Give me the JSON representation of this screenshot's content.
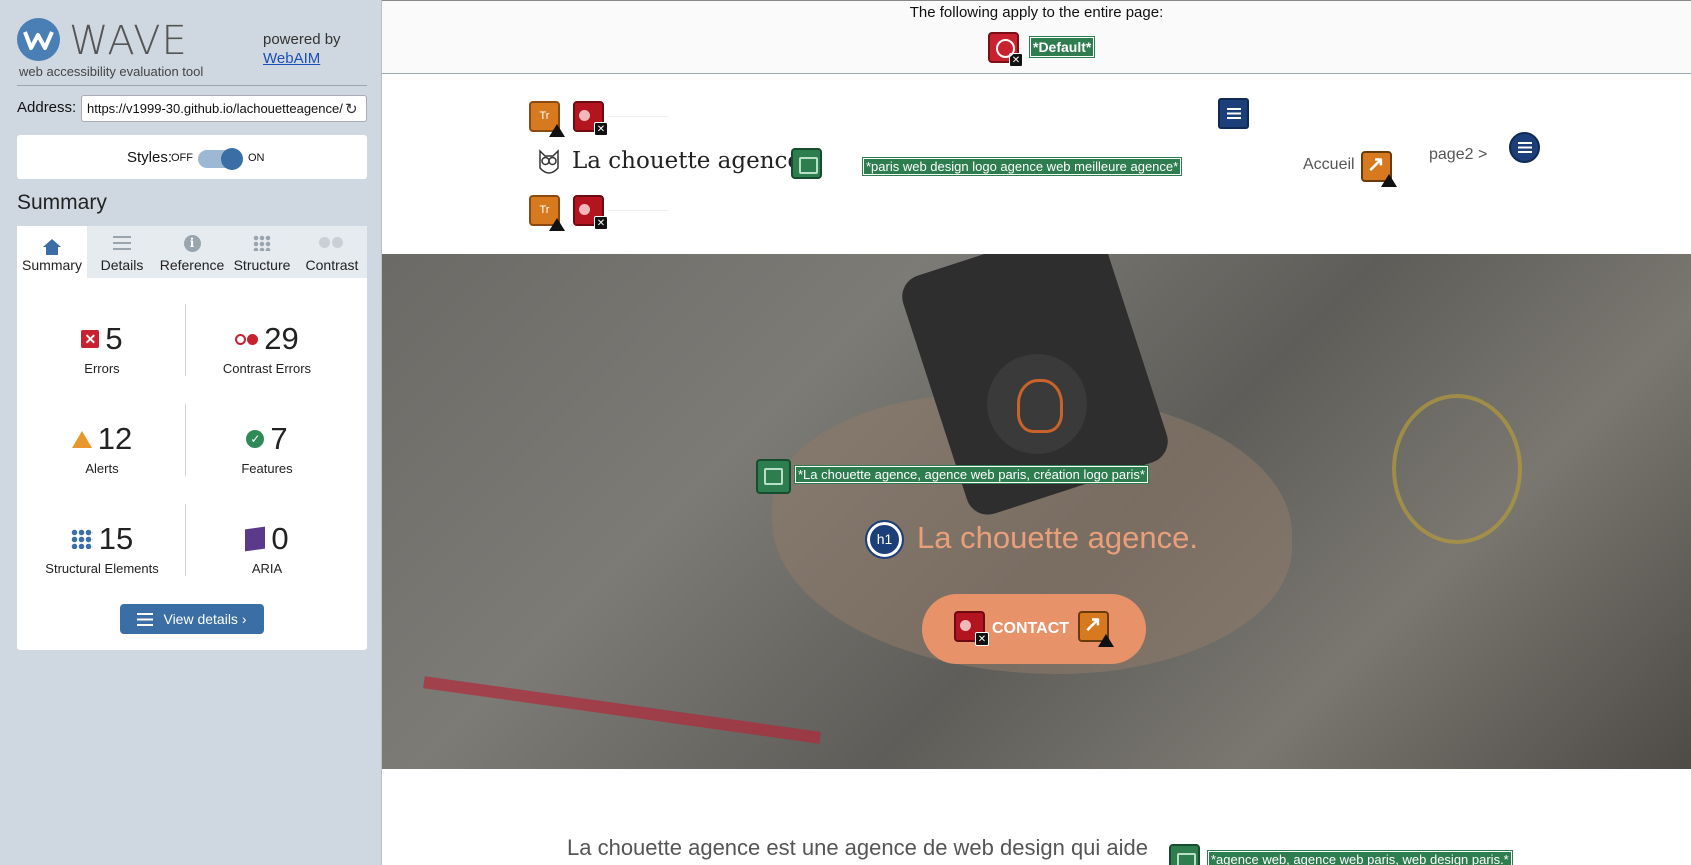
{
  "sidebar": {
    "brand_name": "WAVE",
    "brand_tagline": "web accessibility evaluation tool",
    "powered_by": "powered by",
    "powered_link": "WebAIM",
    "address_label": "Address:",
    "address_value": "https://v1999-30.github.io/lachouetteagence/",
    "styles_label": "Styles:",
    "styles_off": "OFF",
    "styles_on": "ON",
    "summary_title": "Summary",
    "tabs": [
      {
        "label": "Summary",
        "icon": "home-icon"
      },
      {
        "label": "Details",
        "icon": "list-icon"
      },
      {
        "label": "Reference",
        "icon": "info-icon"
      },
      {
        "label": "Structure",
        "icon": "structure-icon"
      },
      {
        "label": "Contrast",
        "icon": "contrast-icon"
      }
    ],
    "stats": {
      "errors": {
        "value": "5",
        "label": "Errors"
      },
      "contrast": {
        "value": "29",
        "label": "Contrast Errors"
      },
      "alerts": {
        "value": "12",
        "label": "Alerts"
      },
      "features": {
        "value": "7",
        "label": "Features"
      },
      "structure": {
        "value": "15",
        "label": "Structural Elements"
      },
      "aria": {
        "value": "0",
        "label": "ARIA"
      }
    },
    "view_details": "View details ›"
  },
  "main": {
    "notice": "The following apply to the entire page:",
    "default_lang": "*Default*",
    "logo_text": "La chouette agence",
    "logo_alt": "*paris web design logo agence web meilleure agence*",
    "nav_home": "Accueil",
    "nav_page2": "page2 >",
    "hero_alt": "*La chouette agence, agence web paris, création logo paris*",
    "hero_h1_badge": "h1",
    "hero_title": "La chouette agence.",
    "contact": "CONTACT",
    "body_text": "La chouette agence est une agence de web design qui aide",
    "body_alt": "*agence web, agence web paris, web design paris.*"
  },
  "colors": {
    "accent": "#3a6ea5",
    "error": "#c8212f",
    "alert": "#e9962c",
    "feature": "#2e7d4f",
    "structure": "#1c3f7a",
    "aria": "#5b3a8c",
    "hero_title": "#e9a07a",
    "contact_bg": "#e8926a"
  }
}
